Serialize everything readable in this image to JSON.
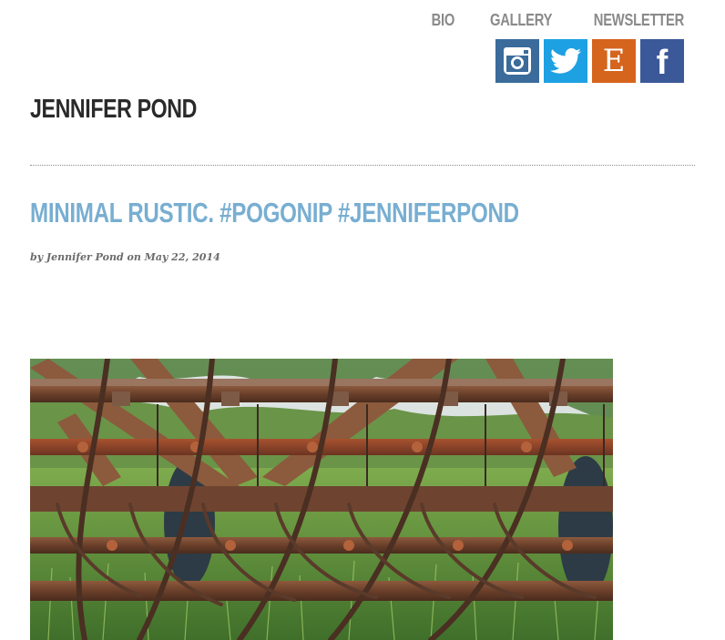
{
  "nav": {
    "items": [
      "Bio",
      "Gallery",
      "Newsletter"
    ]
  },
  "social": {
    "instagram_color": "#3a6b9a",
    "twitter_color": "#1da1e3",
    "etsy_color": "#d5641c",
    "facebook_color": "#3b5998",
    "etsy_letter": "E",
    "facebook_letter": "f"
  },
  "site": {
    "title": "JENNIFER POND"
  },
  "post": {
    "title": "MINIMAL RUSTIC. #POGONIP #JENNIFERPOND",
    "byline": "by Jennifer Pond on May 22, 2014",
    "image_description": "rusty-farm-harrow-photo"
  }
}
